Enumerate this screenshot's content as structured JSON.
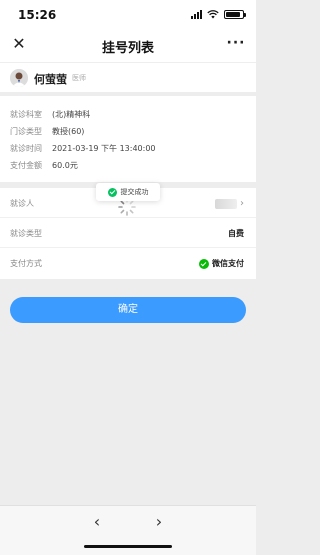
{
  "status_bar": {
    "time": "15:26",
    "battery_level": 0.85
  },
  "nav": {
    "title": "挂号列表",
    "close_icon": "close-icon",
    "more_icon": "more-icon"
  },
  "doctor": {
    "name": "何萤萤",
    "title": "医师"
  },
  "info": {
    "rows": [
      {
        "label": "就诊科室",
        "value": "(北)精神科"
      },
      {
        "label": "门诊类型",
        "value": "教授(60)"
      },
      {
        "label": "就诊时间",
        "value": "2021-03-19 下午 13:40:00"
      },
      {
        "label": "支付金额",
        "value": "60.0元"
      }
    ]
  },
  "form": {
    "patient_label": "就诊人",
    "visit_type_label": "就诊类型",
    "visit_type_value": "自费",
    "payment_label": "支付方式",
    "payment_value": "微信支付"
  },
  "toast": {
    "text": "提交成功"
  },
  "confirm_button": "确定",
  "colors": {
    "primary": "#3b9bff",
    "success": "#07c160",
    "background": "#ededed"
  }
}
